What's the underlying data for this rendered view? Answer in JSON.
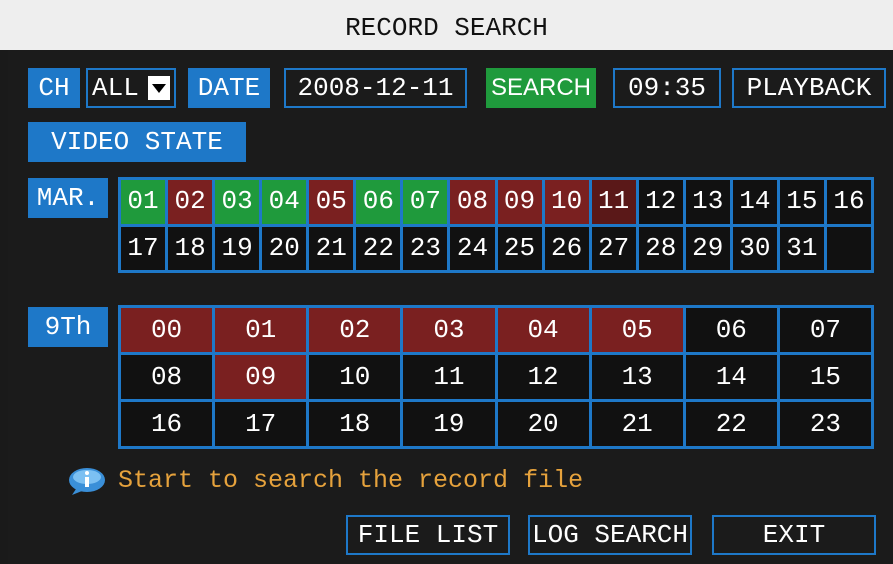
{
  "title": "RECORD SEARCH",
  "toolbar": {
    "ch_label": "CH",
    "ch_value": "ALL",
    "date_label": "DATE",
    "date_value": "2008-12-11",
    "search_label": "SEARCH",
    "time_value": "09:35",
    "playback_label": "PLAYBACK"
  },
  "video_state_label": "VIDEO STATE",
  "month_label": "MAR.",
  "hour_day_label": "9Th",
  "colors": {
    "accent_blue": "#1e78c8",
    "recorded_green": "#1f9a3c",
    "recorded_red": "#7a2020",
    "selected_day": "#5a1818",
    "hint_orange": "#e6a23c"
  },
  "days": [
    {
      "label": "01",
      "state": "green"
    },
    {
      "label": "02",
      "state": "red"
    },
    {
      "label": "03",
      "state": "green"
    },
    {
      "label": "04",
      "state": "green"
    },
    {
      "label": "05",
      "state": "red"
    },
    {
      "label": "06",
      "state": "green"
    },
    {
      "label": "07",
      "state": "green"
    },
    {
      "label": "08",
      "state": "red"
    },
    {
      "label": "09",
      "state": "red"
    },
    {
      "label": "10",
      "state": "red"
    },
    {
      "label": "11",
      "state": "selected"
    },
    {
      "label": "12",
      "state": "none"
    },
    {
      "label": "13",
      "state": "none"
    },
    {
      "label": "14",
      "state": "none"
    },
    {
      "label": "15",
      "state": "none"
    },
    {
      "label": "16",
      "state": "none"
    },
    {
      "label": "17",
      "state": "none"
    },
    {
      "label": "18",
      "state": "none"
    },
    {
      "label": "19",
      "state": "none"
    },
    {
      "label": "20",
      "state": "none"
    },
    {
      "label": "21",
      "state": "none"
    },
    {
      "label": "22",
      "state": "none"
    },
    {
      "label": "23",
      "state": "none"
    },
    {
      "label": "24",
      "state": "none"
    },
    {
      "label": "25",
      "state": "none"
    },
    {
      "label": "26",
      "state": "none"
    },
    {
      "label": "27",
      "state": "none"
    },
    {
      "label": "28",
      "state": "none"
    },
    {
      "label": "29",
      "state": "none"
    },
    {
      "label": "30",
      "state": "none"
    },
    {
      "label": "31",
      "state": "none"
    },
    {
      "label": "",
      "state": "none"
    }
  ],
  "hours": [
    {
      "label": "00",
      "state": "red"
    },
    {
      "label": "01",
      "state": "red"
    },
    {
      "label": "02",
      "state": "red"
    },
    {
      "label": "03",
      "state": "red"
    },
    {
      "label": "04",
      "state": "red"
    },
    {
      "label": "05",
      "state": "red"
    },
    {
      "label": "06",
      "state": "none"
    },
    {
      "label": "07",
      "state": "none"
    },
    {
      "label": "08",
      "state": "none"
    },
    {
      "label": "09",
      "state": "red"
    },
    {
      "label": "10",
      "state": "none"
    },
    {
      "label": "11",
      "state": "none"
    },
    {
      "label": "12",
      "state": "none"
    },
    {
      "label": "13",
      "state": "none"
    },
    {
      "label": "14",
      "state": "none"
    },
    {
      "label": "15",
      "state": "none"
    },
    {
      "label": "16",
      "state": "none"
    },
    {
      "label": "17",
      "state": "none"
    },
    {
      "label": "18",
      "state": "none"
    },
    {
      "label": "19",
      "state": "none"
    },
    {
      "label": "20",
      "state": "none"
    },
    {
      "label": "21",
      "state": "none"
    },
    {
      "label": "22",
      "state": "none"
    },
    {
      "label": "23",
      "state": "none"
    }
  ],
  "hint": {
    "icon": "info-icon",
    "text": "Start to search the record file"
  },
  "buttons": {
    "file_list": "FILE LIST",
    "log_search": "LOG SEARCH",
    "exit": "EXIT"
  }
}
